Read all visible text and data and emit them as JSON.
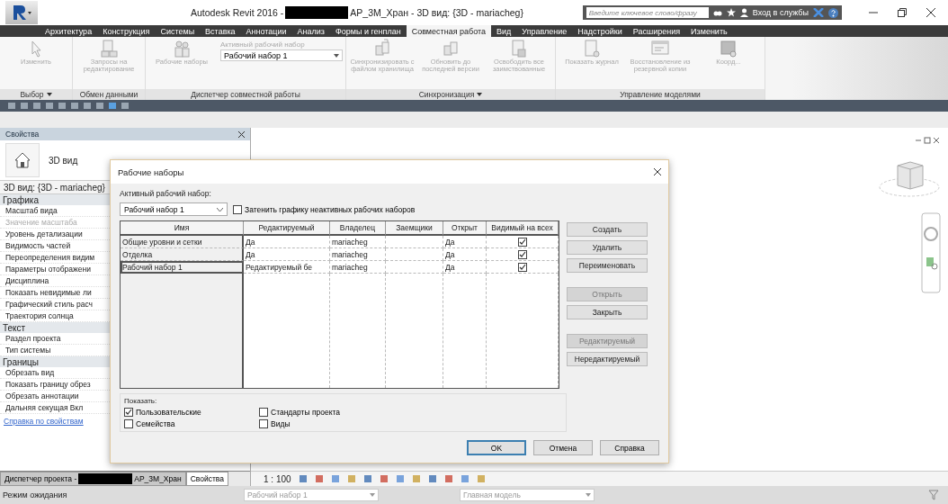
{
  "window": {
    "title_prefix": "Autodesk Revit 2016 -",
    "title_suffix": "AP_3M_Хран - 3D вид: {3D - mariacheg}",
    "search_placeholder": "Введите ключевое слово/фразу",
    "sign_in": "Вход в службы"
  },
  "ribbon_tabs": [
    {
      "label": "Архитектура",
      "selected": false
    },
    {
      "label": "Конструкция",
      "selected": false
    },
    {
      "label": "Системы",
      "selected": false
    },
    {
      "label": "Вставка",
      "selected": false
    },
    {
      "label": "Аннотации",
      "selected": false
    },
    {
      "label": "Анализ",
      "selected": false
    },
    {
      "label": "Формы и генплан",
      "selected": false
    },
    {
      "label": "Совместная работа",
      "selected": true
    },
    {
      "label": "Вид",
      "selected": false
    },
    {
      "label": "Управление",
      "selected": false
    },
    {
      "label": "Надстройки",
      "selected": false
    },
    {
      "label": "Расширения",
      "selected": false
    },
    {
      "label": "Изменить",
      "selected": false
    }
  ],
  "ribbon_panels": [
    {
      "label": "Выбор",
      "dropdown": true,
      "buttons": [
        "Изменить"
      ]
    },
    {
      "label": "Обмен данными",
      "dropdown": false,
      "buttons": [
        "Запросы на редактирование"
      ]
    },
    {
      "label": "Диспетчер совместной работы",
      "dropdown": false,
      "buttons": [
        "Рабочие наборы"
      ],
      "combo": {
        "label": "Активный рабочий набор",
        "value": "Рабочий набор 1"
      }
    },
    {
      "label": "Синхронизация",
      "dropdown": true,
      "buttons": [
        "Синхронизировать с файлом хранилища",
        "Обновить до последней версии",
        "Освободить все заимствованные"
      ]
    },
    {
      "label": "Управление моделями",
      "dropdown": false,
      "buttons": [
        "Показать журнал",
        "Восстановление из резервной копии",
        "Коорд..."
      ]
    }
  ],
  "properties": {
    "title": "Свойства",
    "type_name": "3D вид",
    "instance": "3D вид: {3D - mariacheg}",
    "groups": [
      {
        "name": "Графика",
        "rows": [
          {
            "name": "Масштаб вида",
            "disabled": false
          },
          {
            "name": "Значение масштаба",
            "disabled": true
          },
          {
            "name": "Уровень детализации",
            "disabled": false
          },
          {
            "name": "Видимость частей",
            "disabled": false
          },
          {
            "name": "Переопределения видим",
            "disabled": false
          },
          {
            "name": "Параметры отображени",
            "disabled": false
          },
          {
            "name": "Дисциплина",
            "disabled": false
          },
          {
            "name": "Показать невидимые ли",
            "disabled": false
          },
          {
            "name": "Графический стиль расч",
            "disabled": false
          },
          {
            "name": "Траектория солнца",
            "disabled": false
          }
        ]
      },
      {
        "name": "Текст",
        "rows": [
          {
            "name": "Раздел проекта",
            "disabled": false
          },
          {
            "name": "Тип системы",
            "disabled": false
          }
        ]
      },
      {
        "name": "Границы",
        "rows": [
          {
            "name": "Обрезать вид",
            "disabled": false
          },
          {
            "name": "Показать границу обрез",
            "disabled": false
          },
          {
            "name": "Обрезать аннотации",
            "disabled": false
          },
          {
            "name": "Дальняя секущая Вкл",
            "disabled": false
          }
        ]
      }
    ],
    "help_link": "Справка по свойствам"
  },
  "browser_tabs": [
    {
      "label": "Диспетчер проекта -",
      "suffix": "AP_3M_Хран",
      "selected": false
    },
    {
      "label": "Свойства",
      "selected": true
    }
  ],
  "view_bar": {
    "scale": "1 : 100"
  },
  "dialog": {
    "title": "Рабочие наборы",
    "active_label": "Активный рабочий набор:",
    "active_value": "Рабочий набор 1",
    "gray_inactive": {
      "label": "Затенить графику неактивных рабочих наборов",
      "checked": false
    },
    "columns": [
      "Имя",
      "Редактируемый",
      "Владелец",
      "Заемщики",
      "Открыт",
      "Видимый на всех"
    ],
    "rows": [
      {
        "name": "Общие уровни и сетки",
        "editable": "Да",
        "owner": "mariacheg",
        "open": "Да",
        "visible": true,
        "selected": false
      },
      {
        "name": "Отделка",
        "editable": "Да",
        "owner": "mariacheg",
        "open": "Да",
        "visible": true,
        "selected": false
      },
      {
        "name": "Рабочий набор 1",
        "editable": "Редактируемый бе",
        "owner": "mariacheg",
        "open": "Да",
        "visible": true,
        "selected": true
      }
    ],
    "side_button_groups": [
      [
        {
          "label": "Создать",
          "disabled": false
        },
        {
          "label": "Удалить",
          "disabled": false
        },
        {
          "label": "Переименовать",
          "disabled": false
        }
      ],
      [
        {
          "label": "Открыть",
          "disabled": true
        },
        {
          "label": "Закрыть",
          "disabled": false
        }
      ],
      [
        {
          "label": "Редактируемый",
          "disabled": true
        },
        {
          "label": "Нередактируемый",
          "disabled": false
        }
      ]
    ],
    "show_label": "Показать:",
    "show": [
      {
        "label": "Пользовательские",
        "checked": true
      },
      {
        "label": "Стандарты проекта",
        "checked": false
      },
      {
        "label": "Семейства",
        "checked": false
      },
      {
        "label": "Виды",
        "checked": false
      }
    ],
    "buttons": [
      {
        "label": "OK",
        "default": true
      },
      {
        "label": "Отмена",
        "default": false
      },
      {
        "label": "Справка",
        "default": false
      }
    ]
  },
  "status_bar": {
    "status": "Режим ожидания",
    "workset": "Рабочий набор 1",
    "model": "Главная модель"
  }
}
